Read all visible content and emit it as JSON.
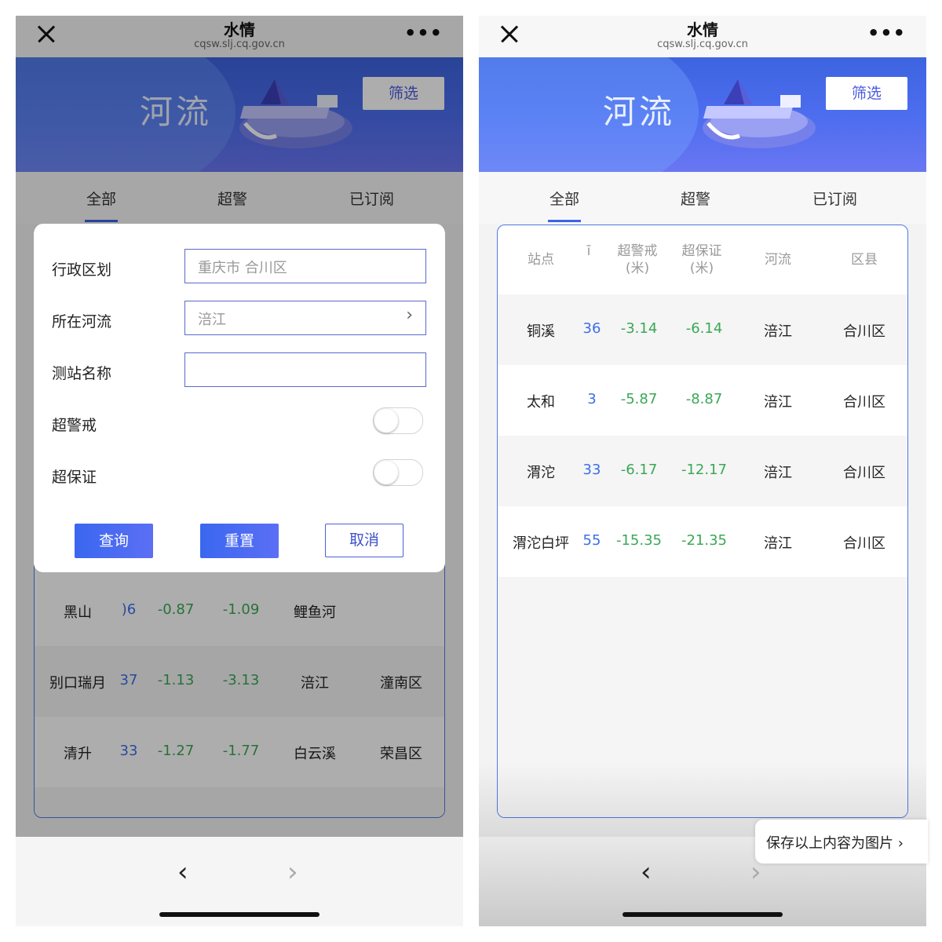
{
  "topbar": {
    "title": "水情",
    "url": "cqsw.slj.cq.gov.cn",
    "more": "•••"
  },
  "banner": {
    "title": "河流",
    "filter_label": "筛选"
  },
  "tabs": [
    {
      "label": "全部"
    },
    {
      "label": "超警"
    },
    {
      "label": "已订阅"
    }
  ],
  "table": {
    "headers": {
      "station": "站点",
      "partial": "ī",
      "over_warning_1": "超警戒",
      "over_warning_2": "(米)",
      "over_guarantee_1": "超保证",
      "over_guarantee_2": "(米)",
      "river": "河流",
      "district": "区县"
    }
  },
  "left": {
    "rows": [
      {
        "station": "黑山",
        "partial": ")6",
        "over_warning": "-0.87",
        "over_guarantee": "-1.09",
        "river": "鲤鱼河",
        "district": ""
      },
      {
        "station": "别口瑞月",
        "partial": "37",
        "over_warning": "-1.13",
        "over_guarantee": "-3.13",
        "river": "涪江",
        "district": "潼南区"
      },
      {
        "station": "清升",
        "partial": "33",
        "over_warning": "-1.27",
        "over_guarantee": "-1.77",
        "river": "白云溪",
        "district": "荣昌区"
      }
    ],
    "modal": {
      "district_label": "行政区划",
      "district_value": "重庆市 合川区",
      "river_label": "所在河流",
      "river_value": "涪江",
      "station_label": "测站名称",
      "station_value": "",
      "over_warning_label": "超警戒",
      "over_guarantee_label": "超保证",
      "query": "查询",
      "reset": "重置",
      "cancel": "取消"
    }
  },
  "right": {
    "rows": [
      {
        "station": "铜溪",
        "partial": "36",
        "over_warning": "-3.14",
        "over_guarantee": "-6.14",
        "river": "涪江",
        "district": "合川区"
      },
      {
        "station": "太和",
        "partial": "3",
        "over_warning": "-5.87",
        "over_guarantee": "-8.87",
        "river": "涪江",
        "district": "合川区"
      },
      {
        "station": "渭沱",
        "partial": "33",
        "over_warning": "-6.17",
        "over_guarantee": "-12.17",
        "river": "涪江",
        "district": "合川区"
      },
      {
        "station": "渭沱白坪",
        "partial": "55",
        "over_warning": "-15.35",
        "over_guarantee": "-21.35",
        "river": "涪江",
        "district": "合川区"
      }
    ],
    "save_label": "保存以上内容为图片 ›"
  },
  "nav": {
    "back": "‹",
    "forward": "›"
  },
  "colors": {
    "accent": "#3c63e8",
    "green": "#3aa855",
    "blue": "#3d6ee6"
  }
}
